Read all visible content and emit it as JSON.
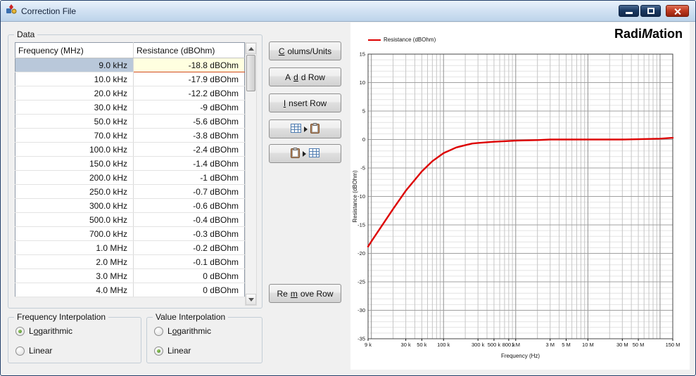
{
  "window": {
    "title": "Correction File"
  },
  "groups": {
    "data": "Data",
    "freq_interp": {
      "title": "Frequency Interpolation",
      "options": [
        {
          "label": "Logarithmic",
          "accel": 1,
          "selected": true
        },
        {
          "label": "Linear",
          "accel": -1,
          "selected": false
        }
      ]
    },
    "value_interp": {
      "title": "Value Interpolation",
      "options": [
        {
          "label": "Logarithmic",
          "accel": 1,
          "selected": false
        },
        {
          "label": "Linear",
          "accel": -1,
          "selected": true
        }
      ]
    }
  },
  "table": {
    "columns": [
      "Frequency (MHz)",
      "Resistance (dBOhm)"
    ],
    "selected_row": 0,
    "rows": [
      [
        "9.0 kHz",
        "-18.8 dBOhm"
      ],
      [
        "10.0 kHz",
        "-17.9 dBOhm"
      ],
      [
        "20.0 kHz",
        "-12.2 dBOhm"
      ],
      [
        "30.0 kHz",
        "-9 dBOhm"
      ],
      [
        "50.0 kHz",
        "-5.6 dBOhm"
      ],
      [
        "70.0 kHz",
        "-3.8 dBOhm"
      ],
      [
        "100.0 kHz",
        "-2.4 dBOhm"
      ],
      [
        "150.0 kHz",
        "-1.4 dBOhm"
      ],
      [
        "200.0 kHz",
        "-1 dBOhm"
      ],
      [
        "250.0 kHz",
        "-0.7 dBOhm"
      ],
      [
        "300.0 kHz",
        "-0.6 dBOhm"
      ],
      [
        "500.0 kHz",
        "-0.4 dBOhm"
      ],
      [
        "700.0 kHz",
        "-0.3 dBOhm"
      ],
      [
        "1.0 MHz",
        "-0.2 dBOhm"
      ],
      [
        "2.0 MHz",
        "-0.1 dBOhm"
      ],
      [
        "3.0 MHz",
        "0 dBOhm"
      ],
      [
        "4.0 MHz",
        "0 dBOhm"
      ]
    ]
  },
  "buttons": {
    "columns_units": {
      "label": "Colums/Units",
      "accel": 0
    },
    "add_row": {
      "label": "Add Row",
      "accel": 1
    },
    "insert_row": {
      "label": "Insert Row",
      "accel": 0
    },
    "remove_row": {
      "label": "Remove Row",
      "accel": 2
    },
    "copy_icon": "table-to-clipboard-icon",
    "paste_icon": "clipboard-to-table-icon"
  },
  "logo": {
    "part1": "Radi",
    "m": "M",
    "part2": "ation"
  },
  "chart_data": {
    "type": "line",
    "title": "",
    "xlabel": "Frequency (Hz)",
    "ylabel": "Resistance (dBOhm)",
    "x_scale": "log",
    "xlim": [
      9000,
      150000000
    ],
    "ylim": [
      -35,
      15
    ],
    "y_major_step": 5,
    "y_minor_step": 1,
    "grid": true,
    "legend_position": "top-left",
    "legend": [
      {
        "name": "Resistance (dBOhm)",
        "color": "#dd0000"
      }
    ],
    "x_ticks": [
      {
        "v": 9000,
        "label": "9 k"
      },
      {
        "v": 30000,
        "label": "30 k"
      },
      {
        "v": 50000,
        "label": "50 k"
      },
      {
        "v": 100000,
        "label": "100 k"
      },
      {
        "v": 300000,
        "label": "300 k"
      },
      {
        "v": 500000,
        "label": "500 k"
      },
      {
        "v": 800000,
        "label": "800 k"
      },
      {
        "v": 1000000,
        "label": "1 M"
      },
      {
        "v": 3000000,
        "label": "3 M"
      },
      {
        "v": 5000000,
        "label": "5 M"
      },
      {
        "v": 10000000,
        "label": "10 M"
      },
      {
        "v": 30000000,
        "label": "30 M"
      },
      {
        "v": 50000000,
        "label": "50 M"
      },
      {
        "v": 150000000,
        "label": "150 M"
      }
    ],
    "series": [
      {
        "name": "Resistance (dBOhm)",
        "color": "#dd0000",
        "points": [
          [
            9000,
            -18.8
          ],
          [
            10000,
            -17.9
          ],
          [
            20000,
            -12.2
          ],
          [
            30000,
            -9
          ],
          [
            50000,
            -5.6
          ],
          [
            70000,
            -3.8
          ],
          [
            100000,
            -2.4
          ],
          [
            150000,
            -1.4
          ],
          [
            200000,
            -1
          ],
          [
            250000,
            -0.7
          ],
          [
            300000,
            -0.6
          ],
          [
            500000,
            -0.4
          ],
          [
            700000,
            -0.3
          ],
          [
            1000000,
            -0.2
          ],
          [
            2000000,
            -0.1
          ],
          [
            3000000,
            0
          ],
          [
            4000000,
            0
          ],
          [
            10000000,
            0
          ],
          [
            30000000,
            0
          ],
          [
            50000000,
            0.05
          ],
          [
            100000000,
            0.15
          ],
          [
            150000000,
            0.3
          ]
        ]
      }
    ]
  }
}
